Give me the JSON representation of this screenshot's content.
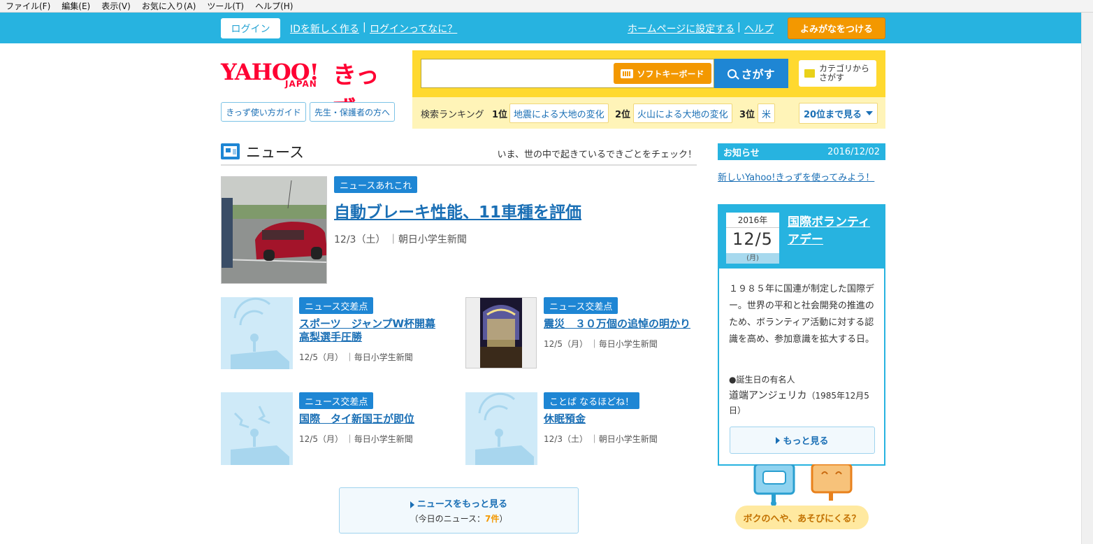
{
  "menubar": [
    "ファイル(F)",
    "編集(E)",
    "表示(V)",
    "お気に入り(A)",
    "ツール(T)",
    "ヘルプ(H)"
  ],
  "topbar": {
    "login": "ログイン",
    "new_id": "IDを新しく作る",
    "about_login": "ログインってなに？",
    "set_home": "ホームページに設定する",
    "help": "ヘルプ",
    "furigana": "よみがなをつける",
    "sep": "|"
  },
  "logo": {
    "yahoo": "YAHOO!",
    "japan": "JAPAN",
    "kids": "きっず"
  },
  "sublinks": {
    "usage": "きっず使い方ガイド",
    "teachers": "先生・保護者の方へ"
  },
  "search": {
    "value": "",
    "soft_keyboard": "ソフトキーボード",
    "submit": "さがす",
    "category": "カテゴリから さがす",
    "ranking_label": "検索ランキング",
    "ranking": [
      {
        "rank": "1位",
        "term": "地震による大地の変化"
      },
      {
        "rank": "2位",
        "term": "火山による大地の変化"
      },
      {
        "rank": "3位",
        "term": "米"
      }
    ],
    "ranking_more": "20位まで見る"
  },
  "news": {
    "title": "ニュース",
    "subtitle": "いま、世の中で起きているできごとをチェック！",
    "top": {
      "tag": "ニュースあれこれ",
      "headline": "自動ブレーキ性能、11車種を評価",
      "meta": "12/3（土） ｜朝日小学生新聞"
    },
    "items": [
      {
        "tag": "ニュース交差点",
        "headline": "スポーツ　ジャンプW杯開幕 高梨選手圧勝",
        "meta": "12/5（月） ｜毎日小学生新聞"
      },
      {
        "tag": "ニュース交差点",
        "headline": "震災　３０万個の追悼の明かり",
        "meta": "12/5（月） ｜毎日小学生新聞"
      },
      {
        "tag": "ニュース交差点",
        "headline": "国際　タイ新国王が即位",
        "meta": "12/5（月） ｜毎日小学生新聞"
      },
      {
        "tag": "ことば なるほどね！",
        "headline": "休眠預金",
        "meta": "12/3（土） ｜朝日小学生新聞"
      }
    ],
    "more": "ニュースをもっと見る",
    "count_prefix": "（今日のニュース：",
    "count": "7件",
    "count_suffix": "）"
  },
  "notice": {
    "title": "お知らせ",
    "date": "2016/12/02",
    "link": "新しいYahoo!きっずを使ってみよう！"
  },
  "today": {
    "year": "2016年",
    "date": "12/5",
    "weekday": "(月)",
    "title": "国際ボランティアデー",
    "description": "１９８５年に国連が制定した国際デー。世界の平和と社会開発の推進のため、ボランティア活動に対する認識を高め、参加意識を拡大する日。",
    "birthday_label": "●誕生日の有名人",
    "birthday_name": "道端アンジェリカ",
    "birthday_date": "（1985年12月5日）",
    "more": "もっと見る"
  },
  "room": {
    "bubble": "ボクのへや、あそびにくる？"
  },
  "colors": {
    "brand_blue": "#27b3e0",
    "link_blue": "#1a6fb5",
    "accent_orange": "#f39800",
    "search_yellow": "#ffd92f"
  }
}
